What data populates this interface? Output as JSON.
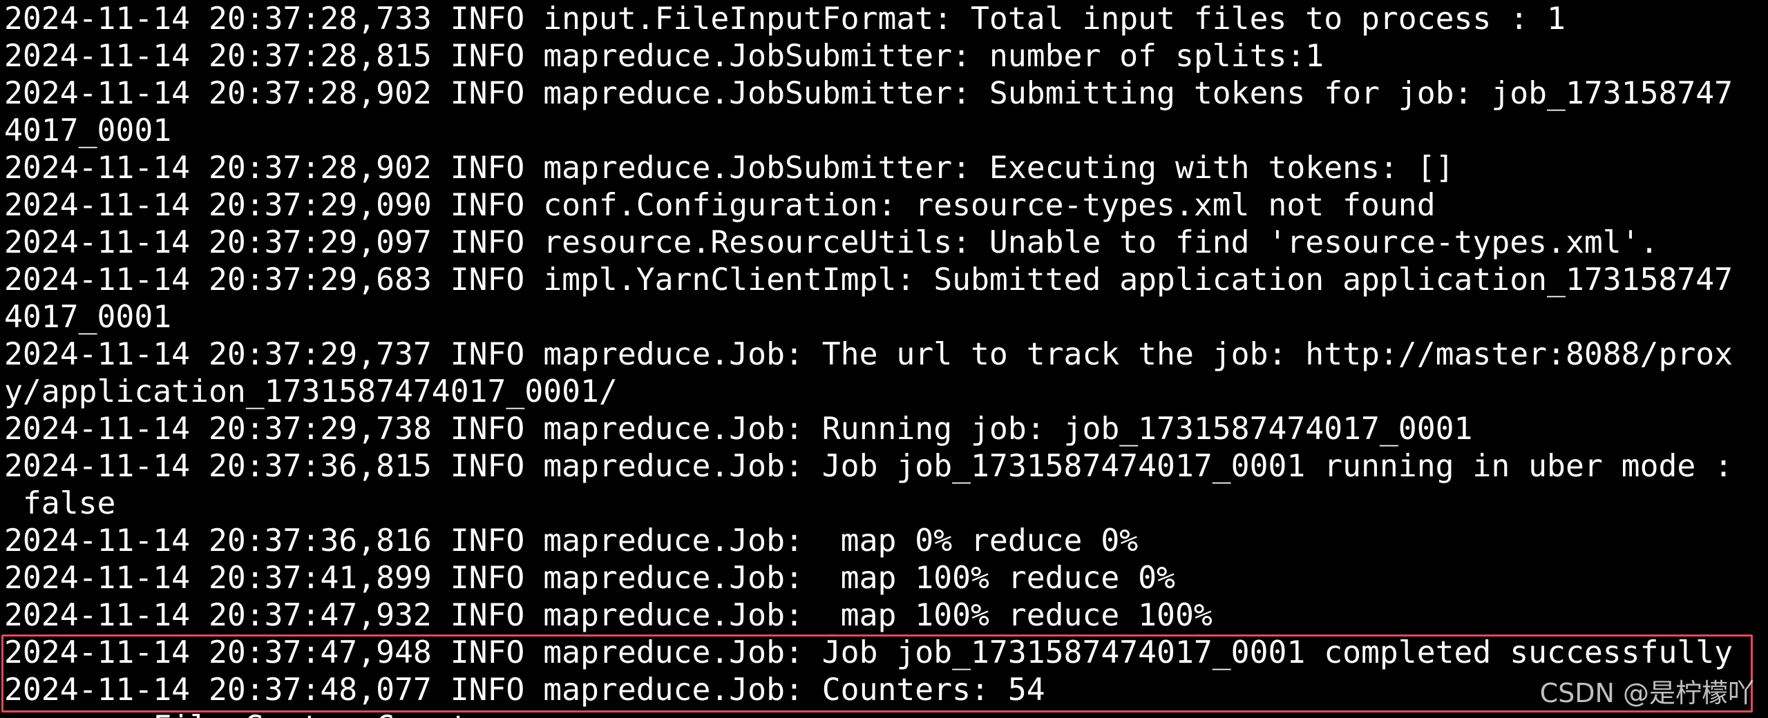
{
  "terminal": {
    "lines": [
      "2024-11-14 20:37:28,733 INFO input.FileInputFormat: Total input files to process : 1",
      "2024-11-14 20:37:28,815 INFO mapreduce.JobSubmitter: number of splits:1",
      "2024-11-14 20:37:28,902 INFO mapreduce.JobSubmitter: Submitting tokens for job: job_173158747",
      "4017_0001",
      "2024-11-14 20:37:28,902 INFO mapreduce.JobSubmitter: Executing with tokens: []",
      "2024-11-14 20:37:29,090 INFO conf.Configuration: resource-types.xml not found",
      "2024-11-14 20:37:29,097 INFO resource.ResourceUtils: Unable to find 'resource-types.xml'.",
      "2024-11-14 20:37:29,683 INFO impl.YarnClientImpl: Submitted application application_173158747",
      "4017_0001",
      "2024-11-14 20:37:29,737 INFO mapreduce.Job: The url to track the job: http://master:8088/prox",
      "y/application_1731587474017_0001/",
      "2024-11-14 20:37:29,738 INFO mapreduce.Job: Running job: job_1731587474017_0001",
      "2024-11-14 20:37:36,815 INFO mapreduce.Job: Job job_1731587474017_0001 running in uber mode :",
      " false",
      "2024-11-14 20:37:36,816 INFO mapreduce.Job:  map 0% reduce 0%",
      "2024-11-14 20:37:41,899 INFO mapreduce.Job:  map 100% reduce 0%",
      "2024-11-14 20:37:47,932 INFO mapreduce.Job:  map 100% reduce 100%",
      "2024-11-14 20:37:47,948 INFO mapreduce.Job: Job job_1731587474017_0001 completed successfully",
      "2024-11-14 20:37:48,077 INFO mapreduce.Job: Counters: 54",
      "        File System Counters"
    ],
    "highlight_color": "#e2495a",
    "background": "#000000",
    "text_color": "#ffffff"
  },
  "watermark": {
    "text": "CSDN @是柠檬吖"
  }
}
